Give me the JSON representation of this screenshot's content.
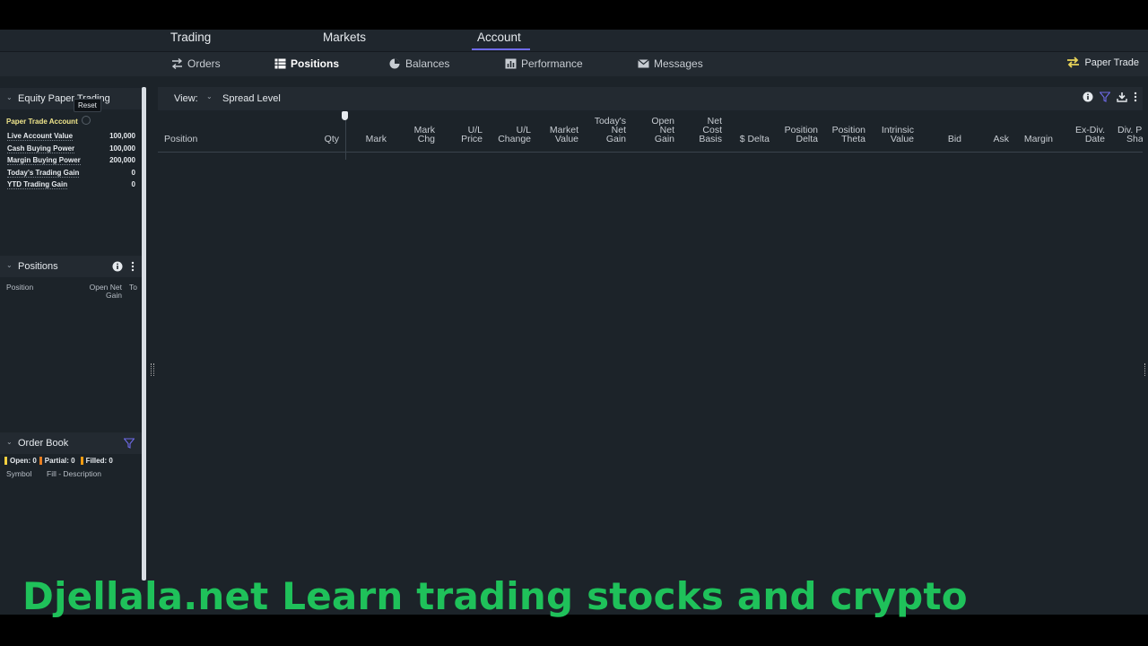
{
  "topnav": {
    "tabs": [
      "Trading",
      "Markets",
      "Account"
    ],
    "active": "Account"
  },
  "subnav": {
    "items": [
      "Orders",
      "Positions",
      "Balances",
      "Performance",
      "Messages"
    ],
    "active": "Positions",
    "paper_trade": "Paper Trade"
  },
  "equity": {
    "title": "Equity Paper Trading",
    "tooltip": "Reset",
    "account_label": "Paper Trade Account",
    "rows": [
      {
        "label": "Live Account Value",
        "value": "100,000"
      },
      {
        "label": "Cash Buying Power",
        "value": "100,000"
      },
      {
        "label": "Margin Buying Power",
        "value": "200,000"
      },
      {
        "label": "Today's Trading Gain",
        "value": "0"
      },
      {
        "label": "YTD Trading Gain",
        "value": "0"
      }
    ]
  },
  "positions_panel": {
    "title": "Positions",
    "col_position": "Position",
    "col_open_net": "Open Net",
    "col_gain": "Gain",
    "col_to": "To"
  },
  "order_book": {
    "title": "Order Book",
    "open": "Open: 0",
    "partial": "Partial: 0",
    "filled": "Filled: 0",
    "col_symbol": "Symbol",
    "col_fill": "Fill - Description"
  },
  "main": {
    "view_label": "View:",
    "spread_level": "Spread Level",
    "columns": [
      [
        "Position"
      ],
      [
        "Qty"
      ],
      [
        "Mark"
      ],
      [
        "Mark",
        "Chg"
      ],
      [
        "U/L",
        "Price"
      ],
      [
        "U/L",
        "Change"
      ],
      [
        "Market",
        "Value"
      ],
      [
        "Today's",
        "Net",
        "Gain"
      ],
      [
        "Open",
        "Net",
        "Gain"
      ],
      [
        "Net",
        "Cost",
        "Basis"
      ],
      [
        "$ Delta"
      ],
      [
        "Position",
        "Delta"
      ],
      [
        "Position",
        "Theta"
      ],
      [
        "Intrinsic",
        "Value"
      ],
      [
        "Bid"
      ],
      [
        "Ask"
      ],
      [
        "Margin"
      ],
      [
        "Ex-Div.",
        "Date"
      ],
      [
        "Div. P",
        "Sha"
      ]
    ]
  },
  "watermark": "Djellala.net Learn trading stocks and crypto",
  "colors": {
    "accent": "#6e6ae8",
    "account_label": "#f0e68c",
    "watermark": "#1fc15a",
    "open": "#f4d03f",
    "partial": "#e67e22",
    "filled": "#f39c12"
  }
}
